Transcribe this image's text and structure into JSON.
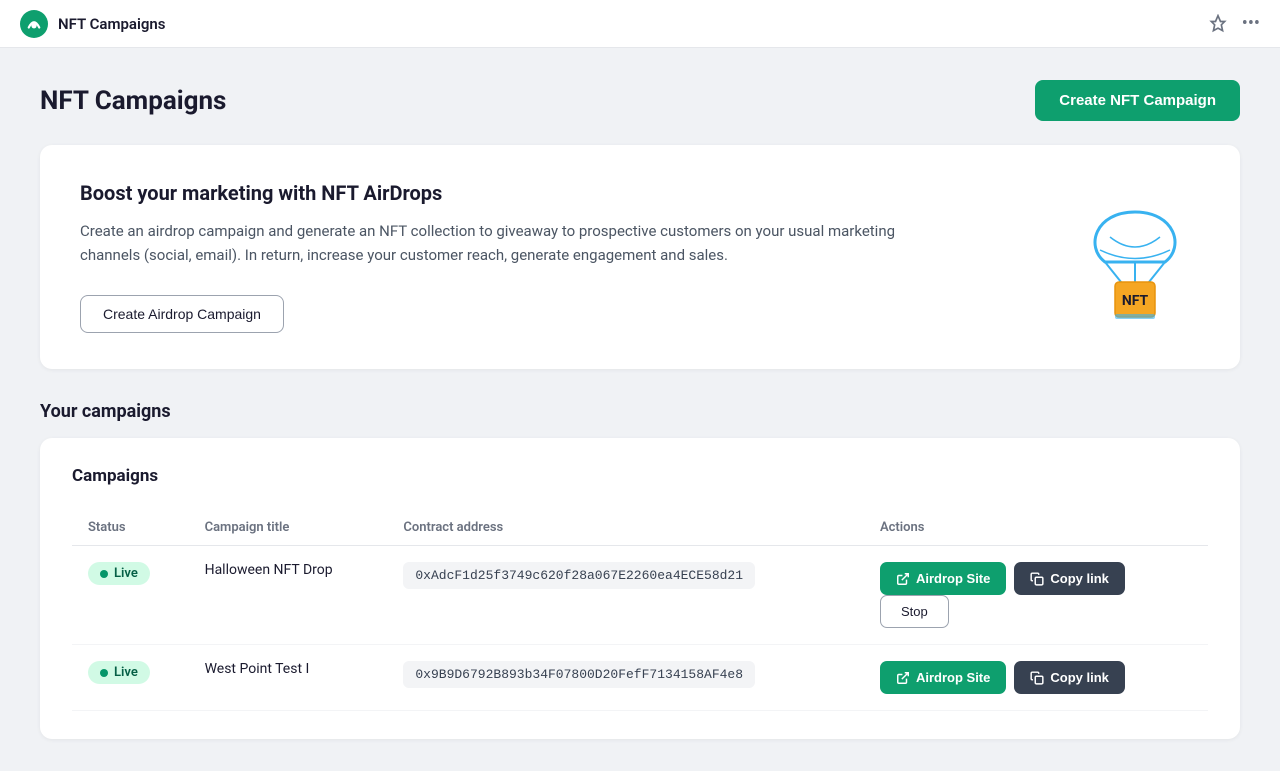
{
  "topbar": {
    "title": "NFT Campaigns",
    "logo_alt": "app-logo"
  },
  "page": {
    "title": "NFT Campaigns",
    "create_nft_button": "Create NFT Campaign"
  },
  "promo": {
    "title": "Boost your marketing with NFT AirDrops",
    "description": "Create an airdrop campaign and generate an NFT collection to giveaway to prospective customers on your usual marketing channels (social, email). In return, increase your customer reach, generate engagement and sales.",
    "cta_button": "Create Airdrop Campaign"
  },
  "campaigns_section": {
    "section_label": "Your campaigns",
    "card_heading": "Campaigns",
    "table_headers": [
      "Status",
      "Campaign title",
      "Contract address",
      "Actions"
    ],
    "campaigns": [
      {
        "status": "Live",
        "title": "Halloween NFT Drop",
        "contract": "0xAdcF1d25f3749c620f28a067E2260ea4ECE58d21",
        "actions": {
          "airdrop_site": "Airdrop Site",
          "copy_link": "Copy link",
          "stop": "Stop"
        }
      },
      {
        "status": "Live",
        "title": "West Point Test I",
        "contract": "0x9B9D6792B893b34F07800D20FefF7134158AF4e8",
        "actions": {
          "airdrop_site": "Airdrop Site",
          "copy_link": "Copy link"
        }
      }
    ]
  },
  "icons": {
    "external_link": "↗",
    "copy": "⧉",
    "pin": "📌",
    "dots": "•••"
  }
}
